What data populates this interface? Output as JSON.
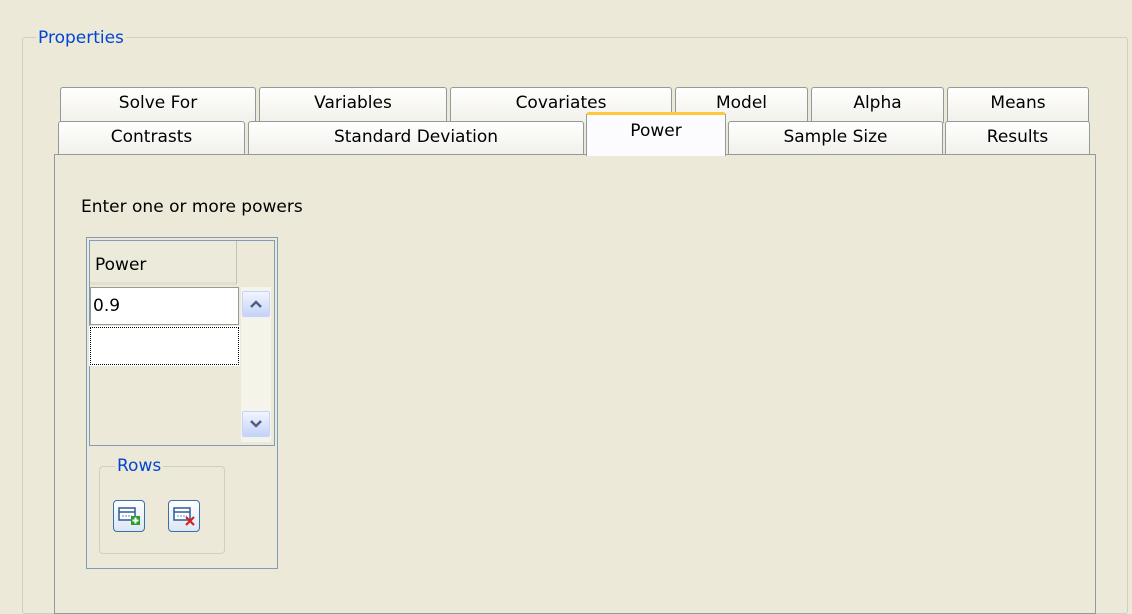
{
  "group_title": "Properties",
  "tabs_row1": [
    "Solve For",
    "Variables",
    "Covariates",
    "Model",
    "Alpha",
    "Means"
  ],
  "tabs_row2": [
    "Contrasts",
    "Standard Deviation",
    "Power",
    "Sample Size",
    "Results"
  ],
  "active_tab": "Power",
  "prompt": "Enter one or more powers",
  "table": {
    "column_header": "Power",
    "rows": [
      "0.9",
      ""
    ]
  },
  "rows_group_title": "Rows",
  "colors": {
    "accent_title": "#0046d5",
    "active_tab_highlight": "#ffc83c",
    "background": "#ece9d8"
  },
  "icons": {
    "add_row": "add-row-icon",
    "delete_row": "delete-row-icon",
    "scroll_up": "chevron-up-icon",
    "scroll_down": "chevron-down-icon"
  }
}
